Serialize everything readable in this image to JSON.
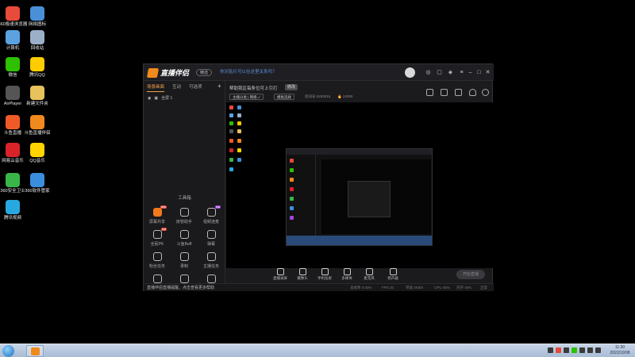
{
  "desktop": {
    "icons": [
      {
        "label": "360极速浏览器",
        "color": "#e84b3a"
      },
      {
        "label": "网络图标",
        "color": "#4a90d9"
      },
      {
        "label": "计算机",
        "color": "#5aa3e0"
      },
      {
        "label": "回收站",
        "color": "#9ab0c8"
      },
      {
        "label": "微信",
        "color": "#2dc100"
      },
      {
        "label": "腾讯QQ",
        "color": "#ffcc00"
      },
      {
        "label": "AirPlayer",
        "color": "#555555"
      },
      {
        "label": "新建文件夹",
        "color": "#e8c25a"
      },
      {
        "label": "斗鱼直播",
        "color": "#f05a28"
      },
      {
        "label": "斗鱼直播伴侣",
        "color": "#f08a1c"
      },
      {
        "label": "网易云音乐",
        "color": "#d8232a"
      },
      {
        "label": "QQ音乐",
        "color": "#ffd400"
      },
      {
        "label": "360安全卫士",
        "color": "#39b54a"
      },
      {
        "label": "360软件管家",
        "color": "#3b8ede"
      },
      {
        "label": "腾讯视频",
        "color": "#28a8e0"
      }
    ]
  },
  "app": {
    "logo_text": "直播伴侣",
    "version_pill": "精选",
    "notice": "你对贴片可以在这里关系吗？",
    "title_icons": [
      "message-icon",
      "mail-icon",
      "skin-icon",
      "menu-icon",
      "minimize-icon",
      "maximize-icon",
      "close-icon"
    ],
    "tabs": [
      {
        "label": "场景画面",
        "active": true
      },
      {
        "label": "互动",
        "active": false
      },
      {
        "label": "可选项",
        "active": false
      }
    ],
    "scene_label": "全屏 1",
    "tools_title": "工具箱",
    "tools": [
      {
        "label": "屏幕共享",
        "hot": true,
        "badge": "new",
        "badge_color": "#e84b3a"
      },
      {
        "label": "房管助手",
        "hot": false,
        "badge": "",
        "badge_color": ""
      },
      {
        "label": "视频连麦",
        "hot": false,
        "badge": "hot",
        "badge_color": "#a046d8"
      },
      {
        "label": "全民PK",
        "hot": false,
        "badge": "hot",
        "badge_color": "#e84b3a"
      },
      {
        "label": "斗鱼Buff",
        "hot": false,
        "badge": "",
        "badge_color": ""
      },
      {
        "label": "弹幕",
        "hot": false,
        "badge": "",
        "badge_color": ""
      },
      {
        "label": "粉丝任务",
        "hot": false,
        "badge": "",
        "badge_color": ""
      },
      {
        "label": "录制",
        "hot": false,
        "badge": "",
        "badge_color": ""
      },
      {
        "label": "主播任务",
        "hot": false,
        "badge": "",
        "badge_color": ""
      },
      {
        "label": "更多",
        "hot": false,
        "badge": "",
        "badge_color": ""
      },
      {
        "label": "",
        "hot": false,
        "badge": "",
        "badge_color": ""
      },
      {
        "label": "",
        "hot": false,
        "badge": "",
        "badge_color": ""
      }
    ],
    "main": {
      "title": "帮助我区每条位可上引打",
      "tag": "修改",
      "btn_edit": "主播分类 | 网络 ✓",
      "btn_template": "模板选择",
      "stat_room": "房间号 5293815",
      "stat_fire": "🔥 24090",
      "right_icons": [
        "record-icon",
        "settings-icon",
        "gift-icon",
        "bell-icon",
        "share-icon"
      ]
    },
    "controls": [
      {
        "label": "直播录屏",
        "icon": "screen-icon"
      },
      {
        "label": "摄像头",
        "icon": "camera-icon"
      },
      {
        "label": "手机投屏",
        "icon": "phone-icon"
      },
      {
        "label": "多媒体",
        "icon": "media-icon"
      },
      {
        "label": "麦克风",
        "icon": "mic-icon"
      },
      {
        "label": "扬声器",
        "icon": "speaker-icon"
      }
    ],
    "start_button": "开始直播",
    "statusbar": {
      "left": "直播伴侣直播提醒，点击查看更多帮助",
      "items": [
        "丢帧率 0.00%",
        "FPS 20",
        "带宽 0KB/s",
        "CPU 46%",
        "内存 40%",
        "正常"
      ]
    }
  },
  "taskbar": {
    "time": "11:30",
    "date": "2022/10/08"
  }
}
